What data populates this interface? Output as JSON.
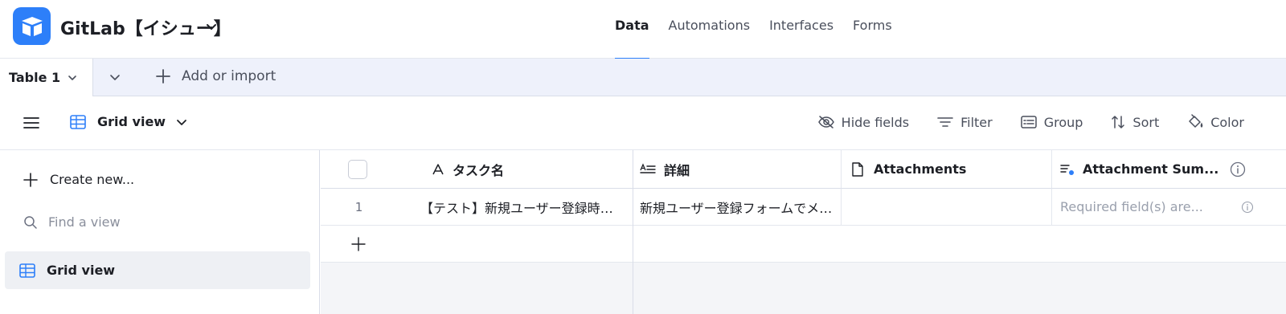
{
  "app": {
    "base_title": "GitLab【イシュー】",
    "nav_tabs": [
      {
        "label": "Data",
        "active": true
      },
      {
        "label": "Automations",
        "active": false
      },
      {
        "label": "Interfaces",
        "active": false
      },
      {
        "label": "Forms",
        "active": false
      }
    ]
  },
  "tables": {
    "current": "Table 1",
    "add_import": "Add or import"
  },
  "viewbar": {
    "current_view": "Grid view",
    "tools": [
      {
        "label": "Hide fields",
        "icon": "eye-slash-icon"
      },
      {
        "label": "Filter",
        "icon": "filter-icon"
      },
      {
        "label": "Group",
        "icon": "group-icon"
      },
      {
        "label": "Sort",
        "icon": "sort-icon"
      },
      {
        "label": "Color",
        "icon": "paint-bucket-icon"
      }
    ]
  },
  "sidebar": {
    "create_new": "Create new...",
    "find_placeholder": "Find a view",
    "views": [
      {
        "label": "Grid view",
        "active": true
      }
    ]
  },
  "grid": {
    "columns": [
      {
        "label": "タスク名",
        "icon": "text-a-icon"
      },
      {
        "label": "詳細",
        "icon": "long-text-icon"
      },
      {
        "label": "Attachments",
        "icon": "file-icon"
      },
      {
        "label": "Attachment Sum...",
        "icon": "ai-summary-icon"
      }
    ],
    "rows": [
      {
        "number": "1",
        "cells": [
          "【テスト】新規ユーザー登録時の...",
          "新規ユーザー登録フォームでメー...",
          "",
          "Required field(s) are..."
        ]
      }
    ]
  },
  "colors": {
    "accent": "#2d7ff9",
    "header_bg": "#eef1fb",
    "muted_text": "#9aa0ad"
  }
}
